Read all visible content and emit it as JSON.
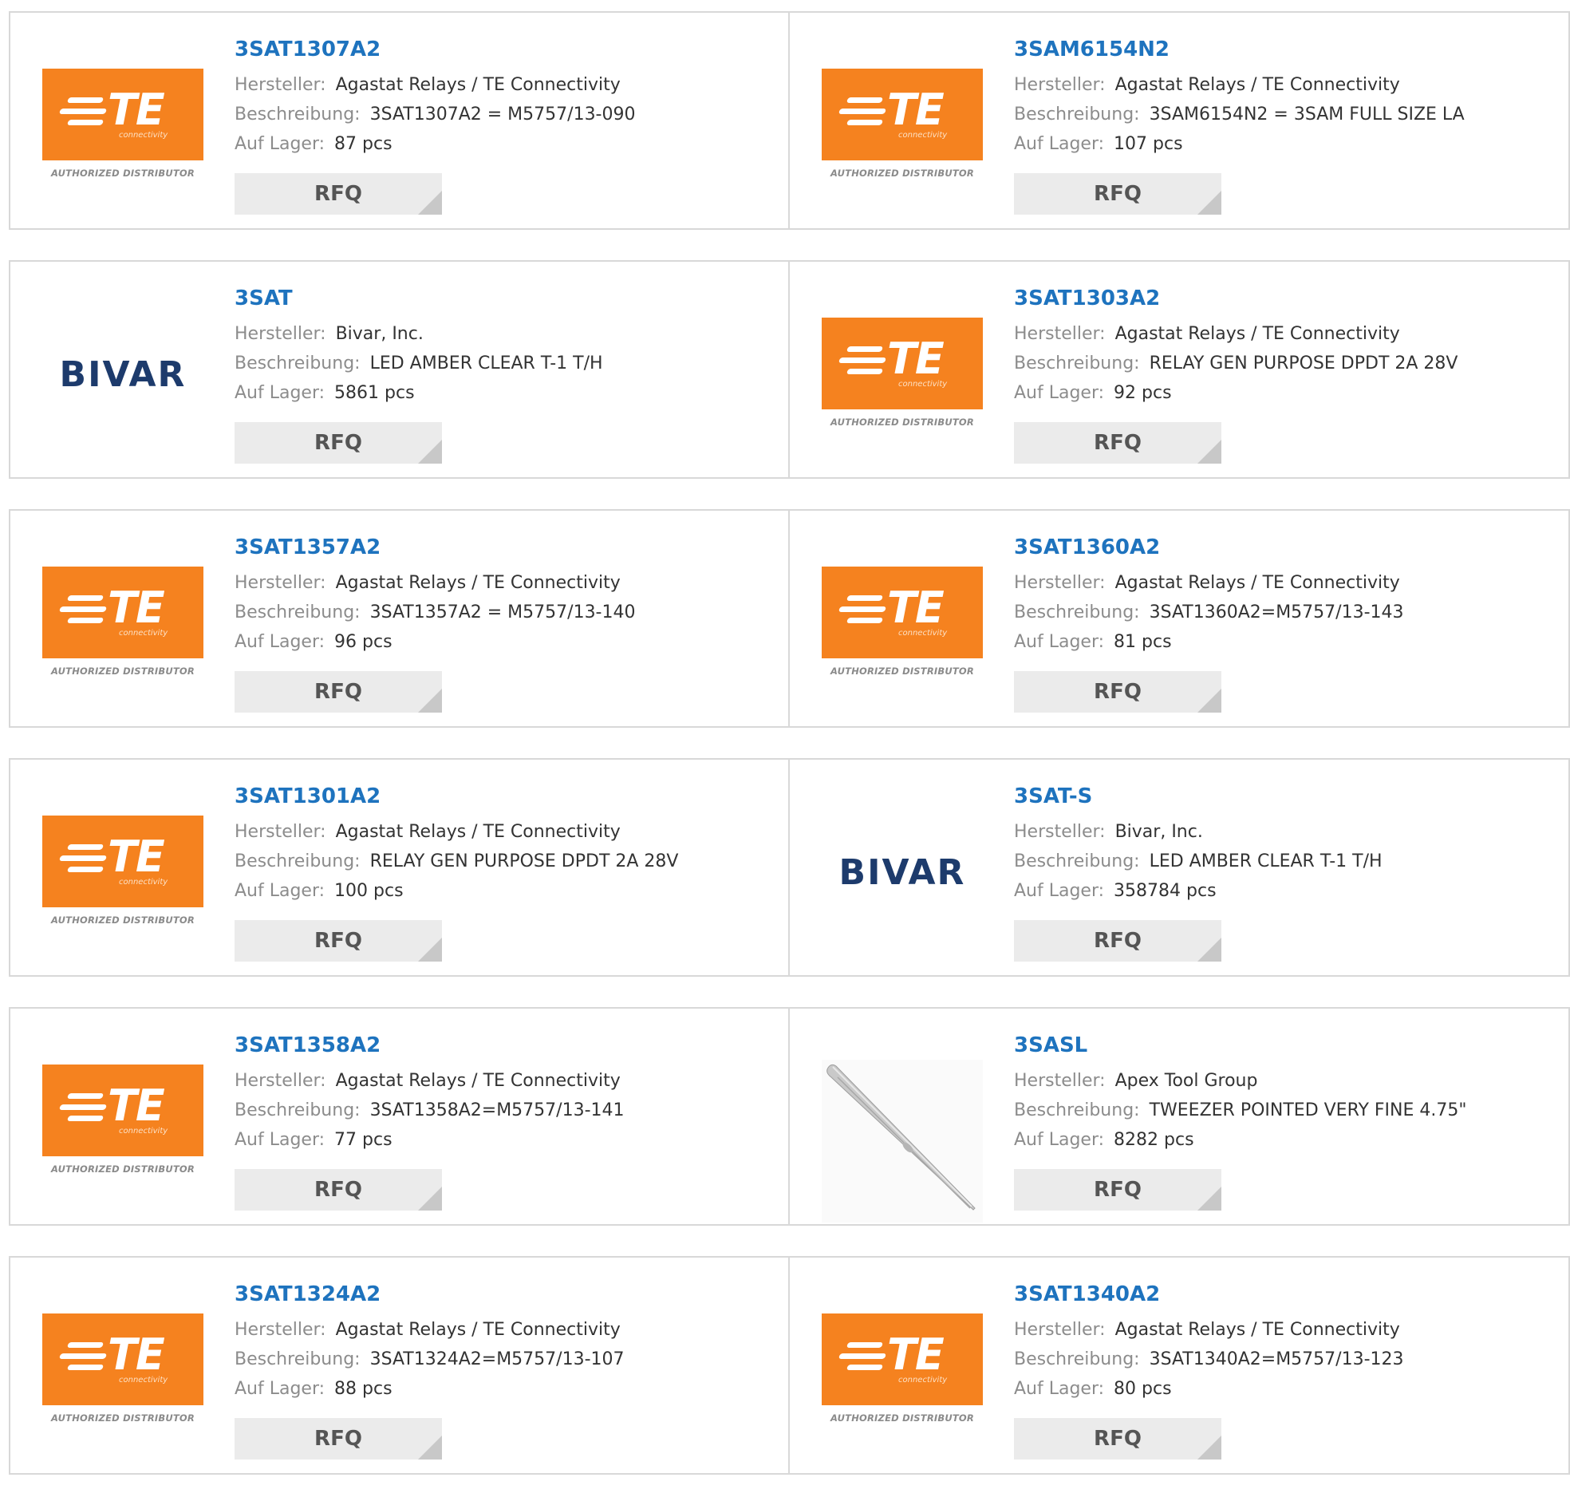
{
  "labels": {
    "manufacturer": "Hersteller:",
    "description": "Beschreibung:",
    "stock": "Auf Lager:",
    "rfq": "RFQ"
  },
  "logo_text": {
    "te": "TE",
    "te_sub": "connectivity",
    "te_caption": "AUTHORIZED DISTRIBUTOR",
    "bivar": "BIVAR"
  },
  "colors": {
    "te_orange": "#f5821f",
    "link_blue": "#1e73be",
    "bivar_navy": "#1d3b6c",
    "rfq_bg": "#ebebeb"
  },
  "products": [
    {
      "part": "3SAT1307A2",
      "logo": "te",
      "manufacturer": "Agastat Relays / TE Connectivity",
      "description": "3SAT1307A2 = M5757/13-090",
      "stock": "87 pcs"
    },
    {
      "part": "3SAM6154N2",
      "logo": "te",
      "manufacturer": "Agastat Relays / TE Connectivity",
      "description": "3SAM6154N2 = 3SAM FULL SIZE LA",
      "stock": "107 pcs"
    },
    {
      "part": "3SAT",
      "logo": "bivar",
      "manufacturer": "Bivar, Inc.",
      "description": "LED AMBER CLEAR T-1 T/H",
      "stock": "5861 pcs"
    },
    {
      "part": "3SAT1303A2",
      "logo": "te",
      "manufacturer": "Agastat Relays / TE Connectivity",
      "description": "RELAY GEN PURPOSE DPDT 2A 28V",
      "stock": "92 pcs"
    },
    {
      "part": "3SAT1357A2",
      "logo": "te",
      "manufacturer": "Agastat Relays / TE Connectivity",
      "description": "3SAT1357A2 = M5757/13-140",
      "stock": "96 pcs"
    },
    {
      "part": "3SAT1360A2",
      "logo": "te",
      "manufacturer": "Agastat Relays / TE Connectivity",
      "description": "3SAT1360A2=M5757/13-143",
      "stock": "81 pcs"
    },
    {
      "part": "3SAT1301A2",
      "logo": "te",
      "manufacturer": "Agastat Relays / TE Connectivity",
      "description": "RELAY GEN PURPOSE DPDT 2A 28V",
      "stock": "100 pcs"
    },
    {
      "part": "3SAT-S",
      "logo": "bivar",
      "manufacturer": "Bivar, Inc.",
      "description": "LED AMBER CLEAR T-1 T/H",
      "stock": "358784 pcs"
    },
    {
      "part": "3SAT1358A2",
      "logo": "te",
      "manufacturer": "Agastat Relays / TE Connectivity",
      "description": "3SAT1358A2=M5757/13-141",
      "stock": "77 pcs"
    },
    {
      "part": "3SASL",
      "logo": "tweezer",
      "manufacturer": "Apex Tool Group",
      "description": "TWEEZER POINTED VERY FINE 4.75\"",
      "stock": "8282 pcs"
    },
    {
      "part": "3SAT1324A2",
      "logo": "te",
      "manufacturer": "Agastat Relays / TE Connectivity",
      "description": "3SAT1324A2=M5757/13-107",
      "stock": "88 pcs"
    },
    {
      "part": "3SAT1340A2",
      "logo": "te",
      "manufacturer": "Agastat Relays / TE Connectivity",
      "description": "3SAT1340A2=M5757/13-123",
      "stock": "80 pcs"
    }
  ]
}
